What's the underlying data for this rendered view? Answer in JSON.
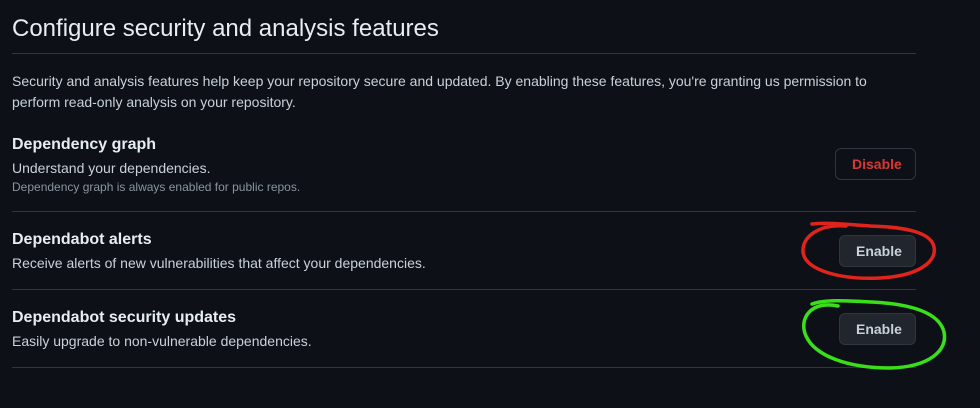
{
  "page": {
    "title": "Configure security and analysis features",
    "intro": "Security and analysis features help keep your repository secure and updated. By enabling these features, you're granting us permission to perform read-only analysis on your repository."
  },
  "features": [
    {
      "name": "Dependency graph",
      "description": "Understand your dependencies.",
      "note": "Dependency graph is always enabled for public repos.",
      "button_label": "Disable"
    },
    {
      "name": "Dependabot alerts",
      "description": "Receive alerts of new vulnerabilities that affect your dependencies.",
      "button_label": "Enable"
    },
    {
      "name": "Dependabot security updates",
      "description": "Easily upgrade to non-vulnerable dependencies.",
      "button_label": "Enable"
    }
  ],
  "colors": {
    "background": "#0d1117",
    "danger": "#da3633",
    "annotation_red": "#e0241c",
    "annotation_green": "#39e019"
  }
}
